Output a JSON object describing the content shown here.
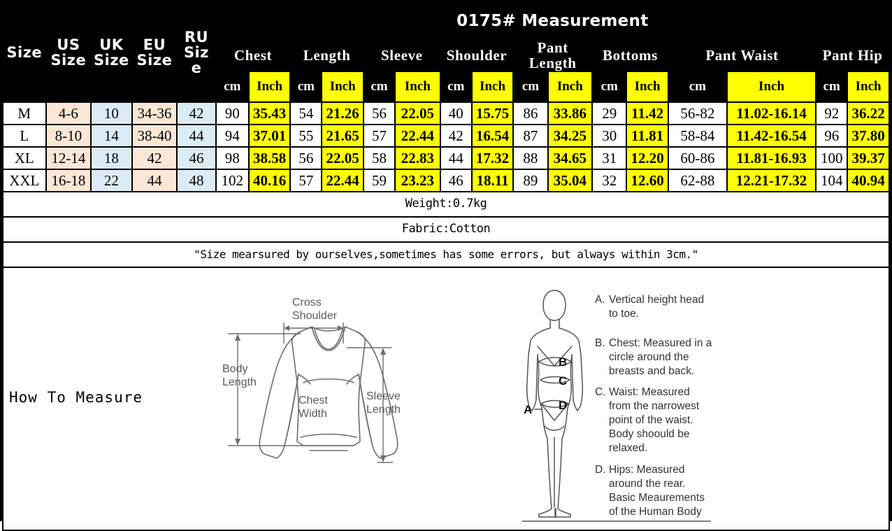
{
  "title": "0175# Measurement",
  "size_columns": [
    {
      "label": "Size",
      "name": "col-size"
    },
    {
      "label": "US Size",
      "name": "col-us-size"
    },
    {
      "label": "UK Size",
      "name": "col-uk-size"
    },
    {
      "label": "EU Size",
      "name": "col-eu-size"
    },
    {
      "label": "RU Size",
      "name": "col-ru-size"
    }
  ],
  "measure_groups": [
    {
      "label": "Chest",
      "name": "group-chest"
    },
    {
      "label": "Length",
      "name": "group-length"
    },
    {
      "label": "Sleeve",
      "name": "group-sleeve"
    },
    {
      "label": "Shoulder",
      "name": "group-shoulder"
    },
    {
      "label": "Pant Length",
      "name": "group-pant-length"
    },
    {
      "label": "Bottoms",
      "name": "group-bottoms"
    },
    {
      "label": "Pant Waist",
      "name": "group-pant-waist"
    },
    {
      "label": "Pant Hip",
      "name": "group-pant-hip"
    }
  ],
  "units": {
    "cm": "cm",
    "inch": "Inch"
  },
  "rows": [
    {
      "size": "M",
      "us": "4-6",
      "uk": "10",
      "eu": "34-36",
      "ru": "42",
      "chest_cm": "90",
      "chest_in": "35.43",
      "length_cm": "54",
      "length_in": "21.26",
      "sleeve_cm": "56",
      "sleeve_in": "22.05",
      "shoulder_cm": "40",
      "shoulder_in": "15.75",
      "pant_length_cm": "86",
      "pant_length_in": "33.86",
      "bottoms_cm": "29",
      "bottoms_in": "11.42",
      "pant_waist_cm": "56-82",
      "pant_waist_in": "11.02-16.14",
      "pant_hip_cm": "92",
      "pant_hip_in": "36.22"
    },
    {
      "size": "L",
      "us": "8-10",
      "uk": "14",
      "eu": "38-40",
      "ru": "44",
      "chest_cm": "94",
      "chest_in": "37.01",
      "length_cm": "55",
      "length_in": "21.65",
      "sleeve_cm": "57",
      "sleeve_in": "22.44",
      "shoulder_cm": "42",
      "shoulder_in": "16.54",
      "pant_length_cm": "87",
      "pant_length_in": "34.25",
      "bottoms_cm": "30",
      "bottoms_in": "11.81",
      "pant_waist_cm": "58-84",
      "pant_waist_in": "11.42-16.54",
      "pant_hip_cm": "96",
      "pant_hip_in": "37.80"
    },
    {
      "size": "XL",
      "us": "12-14",
      "uk": "18",
      "eu": "42",
      "ru": "46",
      "chest_cm": "98",
      "chest_in": "38.58",
      "length_cm": "56",
      "length_in": "22.05",
      "sleeve_cm": "58",
      "sleeve_in": "22.83",
      "shoulder_cm": "44",
      "shoulder_in": "17.32",
      "pant_length_cm": "88",
      "pant_length_in": "34.65",
      "bottoms_cm": "31",
      "bottoms_in": "12.20",
      "pant_waist_cm": "60-86",
      "pant_waist_in": "11.81-16.93",
      "pant_hip_cm": "100",
      "pant_hip_in": "39.37"
    },
    {
      "size": "XXL",
      "us": "16-18",
      "uk": "22",
      "eu": "44",
      "ru": "48",
      "chest_cm": "102",
      "chest_in": "40.16",
      "length_cm": "57",
      "length_in": "22.44",
      "sleeve_cm": "59",
      "sleeve_in": "23.23",
      "shoulder_cm": "46",
      "shoulder_in": "18.11",
      "pant_length_cm": "89",
      "pant_length_in": "35.04",
      "bottoms_cm": "32",
      "bottoms_in": "12.60",
      "pant_waist_cm": "62-88",
      "pant_waist_in": "12.21-17.32",
      "pant_hip_cm": "104",
      "pant_hip_in": "40.94"
    }
  ],
  "notes": {
    "weight": "Weight:0.7kg",
    "fabric": "Fabric:Cotton",
    "disclaimer": "\"Size mearsured by ourselves,sometimes has some errors, but always within 3cm.\""
  },
  "measure_section": {
    "how_to_measure": "How To Measure",
    "garment_labels": {
      "cross_shoulder_line1": "Cross",
      "cross_shoulder_line2": "Shoulder",
      "body_length_line1": "Body",
      "body_length_line2": "Length",
      "chest_width_line1": "Chest",
      "chest_width_line2": "Width",
      "sleeve_length_line1": "Sleeve",
      "sleeve_length_line2": "Length"
    },
    "body_markers": [
      "A",
      "B",
      "C",
      "D"
    ],
    "body_notes": [
      {
        "key": "A.",
        "lines": [
          "Vertical height head",
          "to toe."
        ]
      },
      {
        "key": "B.",
        "lines": [
          "Chest: Measured in a",
          "circle around the",
          "breasts and back."
        ]
      },
      {
        "key": "C.",
        "lines": [
          "Waist: Measured",
          "from the narrowest",
          "point of the waist.",
          "Body shoould be",
          "relaxed."
        ]
      },
      {
        "key": "D.",
        "lines": [
          "Hips: Measured",
          "around the rear.",
          "Basic Meaurements",
          "of the Human Body"
        ]
      }
    ]
  },
  "colors": {
    "header_bg": "#000000",
    "header_fg": "#ffffff",
    "inch_bg": "#ffff00",
    "peach": "#fce7d6",
    "light_blue": "#dcecf6",
    "border": "#000000"
  }
}
